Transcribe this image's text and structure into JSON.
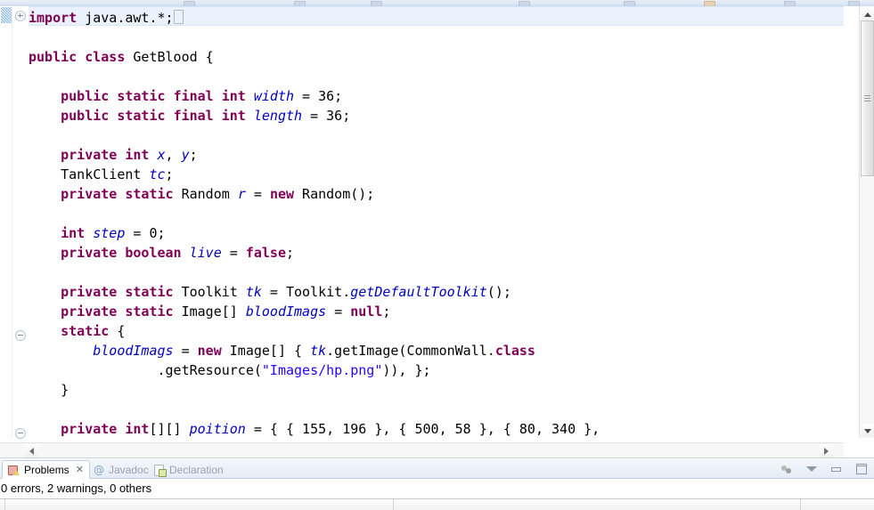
{
  "window": {
    "app": "Eclipse IDE",
    "toolbar_icons": [
      "save-icon",
      "print-icon",
      "debug-icon",
      "run-icon",
      "new-icon",
      "search-icon"
    ]
  },
  "editor": {
    "marker_ruler": {
      "icon": "collapsed-region-marker"
    },
    "fold_icons": [
      {
        "type": "plus",
        "icon": "fold-expand-icon",
        "line": 1
      },
      {
        "type": "minus",
        "icon": "fold-collapse-icon",
        "line": 16
      },
      {
        "type": "minus",
        "icon": "fold-collapse-icon",
        "line": 21
      }
    ],
    "current_line": 1,
    "whitespace_marker": "caret-box",
    "colors": {
      "keyword": "#7F0055",
      "string": "#2A00FF",
      "field": "#0000C0",
      "local": "#6A3EA1",
      "plain": "#000000",
      "current_line_bg": "#EAF2FB"
    },
    "lines": [
      {
        "n": 1,
        "tokens": [
          {
            "t": "import",
            "c": "kw"
          },
          {
            "t": " java.awt.*;",
            "c": "pln"
          }
        ],
        "box_after": true
      },
      {
        "n": 2,
        "tokens": []
      },
      {
        "n": 3,
        "tokens": [
          {
            "t": "public",
            "c": "kw"
          },
          {
            "t": " ",
            "c": "pln"
          },
          {
            "t": "class",
            "c": "kw"
          },
          {
            "t": " GetBlood {",
            "c": "pln"
          }
        ]
      },
      {
        "n": 4,
        "tokens": []
      },
      {
        "n": 5,
        "tokens": [
          {
            "t": "    ",
            "c": "pln"
          },
          {
            "t": "public",
            "c": "kw"
          },
          {
            "t": " ",
            "c": "pln"
          },
          {
            "t": "static",
            "c": "kw"
          },
          {
            "t": " ",
            "c": "pln"
          },
          {
            "t": "final",
            "c": "kw"
          },
          {
            "t": " ",
            "c": "pln"
          },
          {
            "t": "int",
            "c": "kw"
          },
          {
            "t": " ",
            "c": "pln"
          },
          {
            "t": "width",
            "c": "sfld"
          },
          {
            "t": " = 36;",
            "c": "pln"
          }
        ]
      },
      {
        "n": 6,
        "tokens": [
          {
            "t": "    ",
            "c": "pln"
          },
          {
            "t": "public",
            "c": "kw"
          },
          {
            "t": " ",
            "c": "pln"
          },
          {
            "t": "static",
            "c": "kw"
          },
          {
            "t": " ",
            "c": "pln"
          },
          {
            "t": "final",
            "c": "kw"
          },
          {
            "t": " ",
            "c": "pln"
          },
          {
            "t": "int",
            "c": "kw"
          },
          {
            "t": " ",
            "c": "pln"
          },
          {
            "t": "length",
            "c": "sfld"
          },
          {
            "t": " = 36;",
            "c": "pln"
          }
        ]
      },
      {
        "n": 7,
        "tokens": []
      },
      {
        "n": 8,
        "tokens": [
          {
            "t": "    ",
            "c": "pln"
          },
          {
            "t": "private",
            "c": "kw"
          },
          {
            "t": " ",
            "c": "pln"
          },
          {
            "t": "int",
            "c": "kw"
          },
          {
            "t": " ",
            "c": "pln"
          },
          {
            "t": "x",
            "c": "fld"
          },
          {
            "t": ", ",
            "c": "pln"
          },
          {
            "t": "y",
            "c": "fld"
          },
          {
            "t": ";",
            "c": "pln"
          }
        ]
      },
      {
        "n": 9,
        "tokens": [
          {
            "t": "    TankClient ",
            "c": "pln"
          },
          {
            "t": "tc",
            "c": "fld"
          },
          {
            "t": ";",
            "c": "pln"
          }
        ]
      },
      {
        "n": 10,
        "tokens": [
          {
            "t": "    ",
            "c": "pln"
          },
          {
            "t": "private",
            "c": "kw"
          },
          {
            "t": " ",
            "c": "pln"
          },
          {
            "t": "static",
            "c": "kw"
          },
          {
            "t": " Random ",
            "c": "pln"
          },
          {
            "t": "r",
            "c": "sfld"
          },
          {
            "t": " = ",
            "c": "pln"
          },
          {
            "t": "new",
            "c": "kw"
          },
          {
            "t": " Random();",
            "c": "pln"
          }
        ]
      },
      {
        "n": 11,
        "tokens": []
      },
      {
        "n": 12,
        "tokens": [
          {
            "t": "    ",
            "c": "pln"
          },
          {
            "t": "int",
            "c": "kw"
          },
          {
            "t": " ",
            "c": "pln"
          },
          {
            "t": "step",
            "c": "fld"
          },
          {
            "t": " = 0;",
            "c": "pln"
          }
        ]
      },
      {
        "n": 13,
        "tokens": [
          {
            "t": "    ",
            "c": "pln"
          },
          {
            "t": "private",
            "c": "kw"
          },
          {
            "t": " ",
            "c": "pln"
          },
          {
            "t": "boolean",
            "c": "kw"
          },
          {
            "t": " ",
            "c": "pln"
          },
          {
            "t": "live",
            "c": "fld"
          },
          {
            "t": " = ",
            "c": "pln"
          },
          {
            "t": "false",
            "c": "kw"
          },
          {
            "t": ";",
            "c": "pln"
          }
        ]
      },
      {
        "n": 14,
        "tokens": []
      },
      {
        "n": 15,
        "tokens": [
          {
            "t": "    ",
            "c": "pln"
          },
          {
            "t": "private",
            "c": "kw"
          },
          {
            "t": " ",
            "c": "pln"
          },
          {
            "t": "static",
            "c": "kw"
          },
          {
            "t": " Toolkit ",
            "c": "pln"
          },
          {
            "t": "tk",
            "c": "sfld"
          },
          {
            "t": " = Toolkit.",
            "c": "pln"
          },
          {
            "t": "getDefaultToolkit",
            "c": "sfld"
          },
          {
            "t": "();",
            "c": "pln"
          }
        ]
      },
      {
        "n": 16,
        "tokens": [
          {
            "t": "    ",
            "c": "pln"
          },
          {
            "t": "private",
            "c": "kw"
          },
          {
            "t": " ",
            "c": "pln"
          },
          {
            "t": "static",
            "c": "kw"
          },
          {
            "t": " Image[] ",
            "c": "pln"
          },
          {
            "t": "bloodImags",
            "c": "sfld"
          },
          {
            "t": " = ",
            "c": "pln"
          },
          {
            "t": "null",
            "c": "kw"
          },
          {
            "t": ";",
            "c": "pln"
          }
        ]
      },
      {
        "n": 17,
        "tokens": [
          {
            "t": "    ",
            "c": "pln"
          },
          {
            "t": "static",
            "c": "kw"
          },
          {
            "t": " {",
            "c": "pln"
          }
        ]
      },
      {
        "n": 18,
        "tokens": [
          {
            "t": "        ",
            "c": "pln"
          },
          {
            "t": "bloodImags",
            "c": "sfld"
          },
          {
            "t": " = ",
            "c": "pln"
          },
          {
            "t": "new",
            "c": "kw"
          },
          {
            "t": " Image[] { ",
            "c": "pln"
          },
          {
            "t": "tk",
            "c": "sfld"
          },
          {
            "t": ".getImage(CommonWall.",
            "c": "pln"
          },
          {
            "t": "class",
            "c": "kw"
          }
        ]
      },
      {
        "n": 19,
        "tokens": [
          {
            "t": "                .getResource(",
            "c": "pln"
          },
          {
            "t": "\"Images/hp.png\"",
            "c": "str"
          },
          {
            "t": ")), };",
            "c": "pln"
          }
        ]
      },
      {
        "n": 20,
        "tokens": [
          {
            "t": "    }",
            "c": "pln"
          }
        ]
      },
      {
        "n": 21,
        "tokens": []
      },
      {
        "n": 22,
        "tokens": [
          {
            "t": "    ",
            "c": "pln"
          },
          {
            "t": "private",
            "c": "kw"
          },
          {
            "t": " ",
            "c": "pln"
          },
          {
            "t": "int",
            "c": "kw"
          },
          {
            "t": "[][] ",
            "c": "pln"
          },
          {
            "t": "poition",
            "c": "fld"
          },
          {
            "t": " = { { 155, 196 }, { 500, 58 }, { 80, 340 },",
            "c": "pln"
          }
        ]
      }
    ],
    "vscroll": {
      "up_icon": "scroll-up-arrow",
      "down_icon": "scroll-down-arrow",
      "thumb": "scroll-thumb"
    },
    "hscroll": {
      "left_icon": "scroll-left-arrow",
      "right_icon": "scroll-right-arrow"
    }
  },
  "bottom_view": {
    "tabs": [
      {
        "label": "Problems",
        "icon": "problems-icon",
        "active": true,
        "closeable": true,
        "close_glyph": "✕"
      },
      {
        "label": "Javadoc",
        "icon": "javadoc-icon",
        "active": false,
        "closeable": false
      },
      {
        "label": "Declaration",
        "icon": "declaration-icon",
        "active": false,
        "closeable": false
      }
    ],
    "summary": "0 errors, 2 warnings, 0 others",
    "tools": [
      {
        "name": "filter-icon"
      },
      {
        "name": "view-menu-icon"
      },
      {
        "name": "minimize-icon"
      },
      {
        "name": "maximize-icon"
      }
    ],
    "table_columns": [
      "",
      "",
      ""
    ]
  }
}
